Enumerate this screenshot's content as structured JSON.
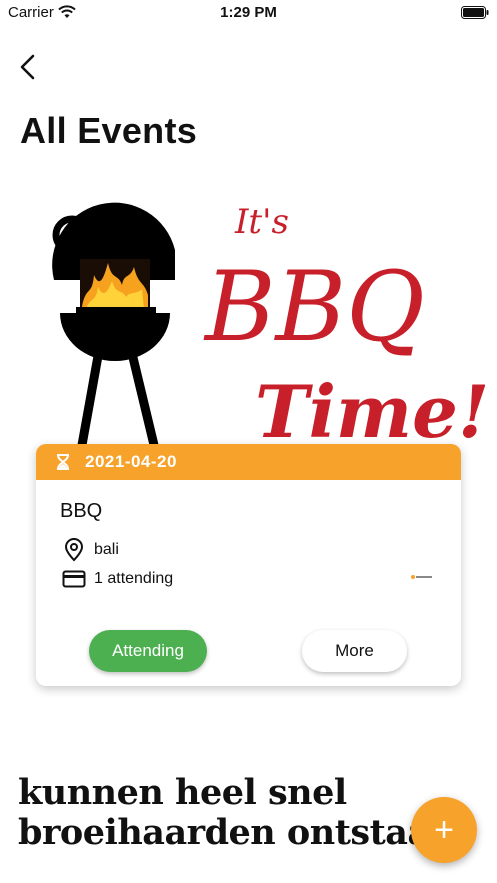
{
  "status_bar": {
    "carrier": "Carrier",
    "time": "1:29 PM"
  },
  "header": {
    "title": "All Events"
  },
  "hero": {
    "text_top": "It's",
    "text_main": "BBQ",
    "text_bottom": "Time!"
  },
  "event": {
    "date": "2021-04-20",
    "name": "BBQ",
    "location": "bali",
    "attending": "1 attending",
    "sponsor": "logo",
    "attending_button": "Attending",
    "more_button": "More"
  },
  "news": {
    "line1": "kunnen heel snel",
    "line2": "broeihaarden ontstaan"
  },
  "fab": {
    "label": "+"
  },
  "colors": {
    "accent": "#f7a22b",
    "attending": "#4caf50",
    "bbq_red": "#c8202a"
  }
}
